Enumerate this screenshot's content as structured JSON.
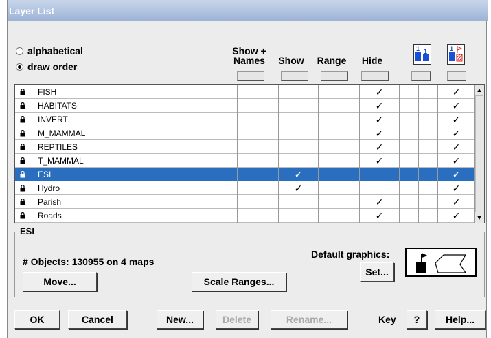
{
  "window": {
    "title": "Layer List"
  },
  "sort": {
    "options": [
      {
        "label": "alphabetical",
        "selected": false
      },
      {
        "label": "draw order",
        "selected": true
      }
    ]
  },
  "columns": {
    "show_names": "Show +\nNames",
    "show": "Show",
    "range": "Range",
    "hide": "Hide"
  },
  "layers": [
    {
      "name": "FISH",
      "show": false,
      "hide": true,
      "last": true,
      "selected": false
    },
    {
      "name": "HABITATS",
      "show": false,
      "hide": true,
      "last": true,
      "selected": false
    },
    {
      "name": "INVERT",
      "show": false,
      "hide": true,
      "last": true,
      "selected": false
    },
    {
      "name": "M_MAMMAL",
      "show": false,
      "hide": true,
      "last": true,
      "selected": false
    },
    {
      "name": "REPTILES",
      "show": false,
      "hide": true,
      "last": true,
      "selected": false
    },
    {
      "name": "T_MAMMAL",
      "show": false,
      "hide": true,
      "last": true,
      "selected": false
    },
    {
      "name": "ESI",
      "show": true,
      "hide": false,
      "last": true,
      "selected": true
    },
    {
      "name": "Hydro",
      "show": true,
      "hide": false,
      "last": true,
      "selected": false
    },
    {
      "name": "Parish",
      "show": false,
      "hide": true,
      "last": true,
      "selected": false
    },
    {
      "name": "Roads",
      "show": false,
      "hide": true,
      "last": true,
      "selected": false
    }
  ],
  "check_glyph": "✓",
  "details": {
    "group_label": "ESI",
    "objects": "# Objects: 130955 on 4 maps",
    "default_graphics": "Default graphics:",
    "set_button": "Set...",
    "move_button": "Move...",
    "scale_ranges_button": "Scale Ranges..."
  },
  "footer": {
    "ok": "OK",
    "cancel": "Cancel",
    "new": "New...",
    "delete": "Delete",
    "rename": "Rename...",
    "key": "Key",
    "question": "?",
    "help": "Help..."
  },
  "colors": {
    "selection": "#2a6fbf",
    "title_bar": "#9db3d6"
  }
}
